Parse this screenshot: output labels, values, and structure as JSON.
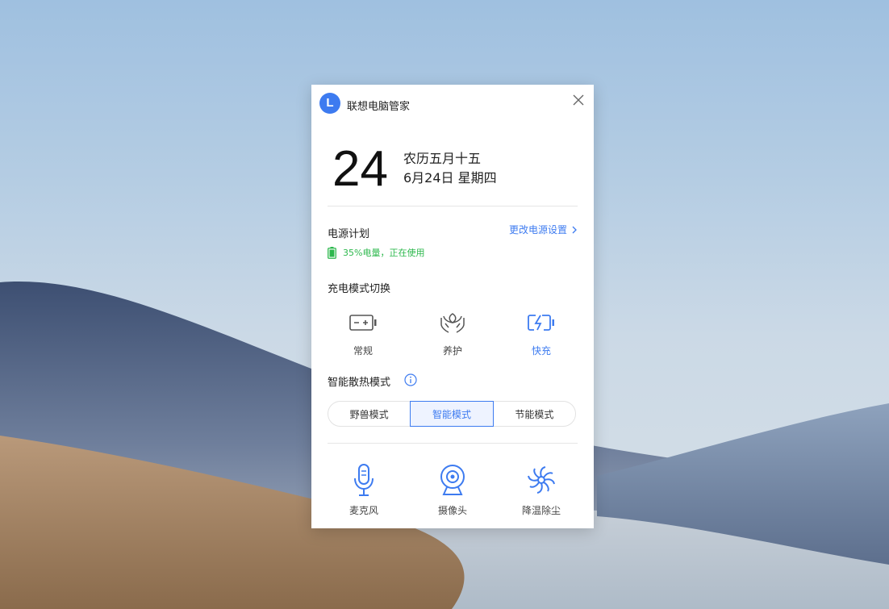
{
  "app": {
    "logo_letter": "L",
    "title": "联想电脑管家"
  },
  "date": {
    "day": "24",
    "lunar": "农历五月十五",
    "full": "6月24日 星期四"
  },
  "power": {
    "title": "电源计划",
    "link": "更改电源设置",
    "battery_status": "35%电量，正在使用",
    "battery_level": 0.35,
    "status_color": "#2db84d"
  },
  "charge_mode": {
    "title": "充电模式切换",
    "items": [
      {
        "label": "常规",
        "icon": "battery-normal-icon",
        "active": false
      },
      {
        "label": "养护",
        "icon": "leaf-care-icon",
        "active": false
      },
      {
        "label": "快充",
        "icon": "fast-charge-icon",
        "active": true
      }
    ]
  },
  "cooling": {
    "title": "智能散热模式",
    "options": [
      "野兽模式",
      "智能模式",
      "节能模式"
    ],
    "selected": "智能模式"
  },
  "tools": [
    {
      "label": "麦克风",
      "icon": "microphone-icon"
    },
    {
      "label": "摄像头",
      "icon": "camera-icon"
    },
    {
      "label": "降温除尘",
      "icon": "fan-icon"
    }
  ],
  "colors": {
    "accent": "#3d7bf0",
    "logo_bg": "#3d7bf0"
  }
}
